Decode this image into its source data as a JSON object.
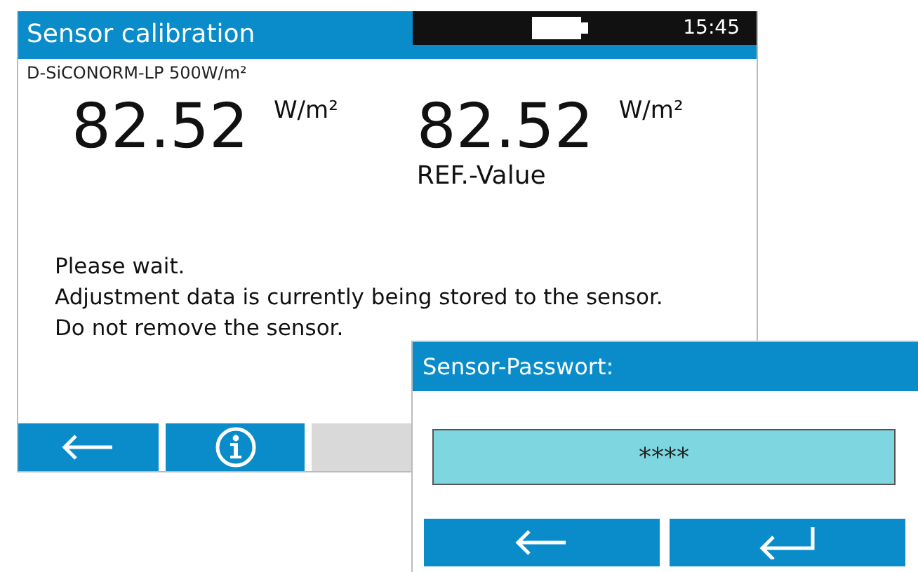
{
  "screen": {
    "title": "Sensor calibration",
    "time": "15:45",
    "sensor": "D-SiCONORM-LP 500W/m²"
  },
  "readings": [
    {
      "value": "82.52",
      "unit": "W/m²"
    },
    {
      "value": "82.52",
      "unit": "W/m²",
      "caption": "REF.-Value"
    }
  ],
  "message": [
    "Please wait.",
    "Adjustment data is currently being stored to the sensor.",
    "Do not remove the sensor."
  ],
  "footer_buttons": [
    {
      "kind": "back"
    },
    {
      "kind": "info"
    },
    {
      "kind": "blank"
    }
  ],
  "dialog": {
    "title": "Sensor-Passwort:",
    "value": "****",
    "buttons": [
      {
        "kind": "back"
      },
      {
        "kind": "enter"
      }
    ]
  }
}
